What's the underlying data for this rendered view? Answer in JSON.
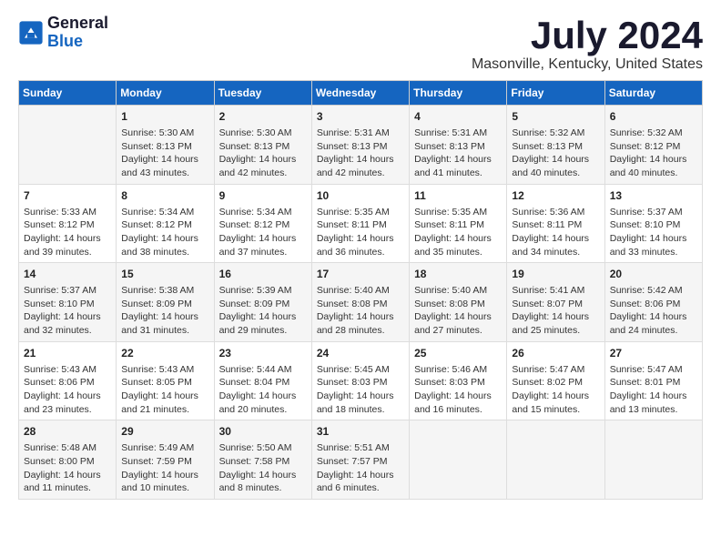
{
  "header": {
    "logo_general": "General",
    "logo_blue": "Blue",
    "title": "July 2024",
    "subtitle": "Masonville, Kentucky, United States"
  },
  "days_of_week": [
    "Sunday",
    "Monday",
    "Tuesday",
    "Wednesday",
    "Thursday",
    "Friday",
    "Saturday"
  ],
  "weeks": [
    [
      {
        "day": "",
        "info": ""
      },
      {
        "day": "1",
        "info": "Sunrise: 5:30 AM\nSunset: 8:13 PM\nDaylight: 14 hours\nand 43 minutes."
      },
      {
        "day": "2",
        "info": "Sunrise: 5:30 AM\nSunset: 8:13 PM\nDaylight: 14 hours\nand 42 minutes."
      },
      {
        "day": "3",
        "info": "Sunrise: 5:31 AM\nSunset: 8:13 PM\nDaylight: 14 hours\nand 42 minutes."
      },
      {
        "day": "4",
        "info": "Sunrise: 5:31 AM\nSunset: 8:13 PM\nDaylight: 14 hours\nand 41 minutes."
      },
      {
        "day": "5",
        "info": "Sunrise: 5:32 AM\nSunset: 8:13 PM\nDaylight: 14 hours\nand 40 minutes."
      },
      {
        "day": "6",
        "info": "Sunrise: 5:32 AM\nSunset: 8:12 PM\nDaylight: 14 hours\nand 40 minutes."
      }
    ],
    [
      {
        "day": "7",
        "info": "Sunrise: 5:33 AM\nSunset: 8:12 PM\nDaylight: 14 hours\nand 39 minutes."
      },
      {
        "day": "8",
        "info": "Sunrise: 5:34 AM\nSunset: 8:12 PM\nDaylight: 14 hours\nand 38 minutes."
      },
      {
        "day": "9",
        "info": "Sunrise: 5:34 AM\nSunset: 8:12 PM\nDaylight: 14 hours\nand 37 minutes."
      },
      {
        "day": "10",
        "info": "Sunrise: 5:35 AM\nSunset: 8:11 PM\nDaylight: 14 hours\nand 36 minutes."
      },
      {
        "day": "11",
        "info": "Sunrise: 5:35 AM\nSunset: 8:11 PM\nDaylight: 14 hours\nand 35 minutes."
      },
      {
        "day": "12",
        "info": "Sunrise: 5:36 AM\nSunset: 8:11 PM\nDaylight: 14 hours\nand 34 minutes."
      },
      {
        "day": "13",
        "info": "Sunrise: 5:37 AM\nSunset: 8:10 PM\nDaylight: 14 hours\nand 33 minutes."
      }
    ],
    [
      {
        "day": "14",
        "info": "Sunrise: 5:37 AM\nSunset: 8:10 PM\nDaylight: 14 hours\nand 32 minutes."
      },
      {
        "day": "15",
        "info": "Sunrise: 5:38 AM\nSunset: 8:09 PM\nDaylight: 14 hours\nand 31 minutes."
      },
      {
        "day": "16",
        "info": "Sunrise: 5:39 AM\nSunset: 8:09 PM\nDaylight: 14 hours\nand 29 minutes."
      },
      {
        "day": "17",
        "info": "Sunrise: 5:40 AM\nSunset: 8:08 PM\nDaylight: 14 hours\nand 28 minutes."
      },
      {
        "day": "18",
        "info": "Sunrise: 5:40 AM\nSunset: 8:08 PM\nDaylight: 14 hours\nand 27 minutes."
      },
      {
        "day": "19",
        "info": "Sunrise: 5:41 AM\nSunset: 8:07 PM\nDaylight: 14 hours\nand 25 minutes."
      },
      {
        "day": "20",
        "info": "Sunrise: 5:42 AM\nSunset: 8:06 PM\nDaylight: 14 hours\nand 24 minutes."
      }
    ],
    [
      {
        "day": "21",
        "info": "Sunrise: 5:43 AM\nSunset: 8:06 PM\nDaylight: 14 hours\nand 23 minutes."
      },
      {
        "day": "22",
        "info": "Sunrise: 5:43 AM\nSunset: 8:05 PM\nDaylight: 14 hours\nand 21 minutes."
      },
      {
        "day": "23",
        "info": "Sunrise: 5:44 AM\nSunset: 8:04 PM\nDaylight: 14 hours\nand 20 minutes."
      },
      {
        "day": "24",
        "info": "Sunrise: 5:45 AM\nSunset: 8:03 PM\nDaylight: 14 hours\nand 18 minutes."
      },
      {
        "day": "25",
        "info": "Sunrise: 5:46 AM\nSunset: 8:03 PM\nDaylight: 14 hours\nand 16 minutes."
      },
      {
        "day": "26",
        "info": "Sunrise: 5:47 AM\nSunset: 8:02 PM\nDaylight: 14 hours\nand 15 minutes."
      },
      {
        "day": "27",
        "info": "Sunrise: 5:47 AM\nSunset: 8:01 PM\nDaylight: 14 hours\nand 13 minutes."
      }
    ],
    [
      {
        "day": "28",
        "info": "Sunrise: 5:48 AM\nSunset: 8:00 PM\nDaylight: 14 hours\nand 11 minutes."
      },
      {
        "day": "29",
        "info": "Sunrise: 5:49 AM\nSunset: 7:59 PM\nDaylight: 14 hours\nand 10 minutes."
      },
      {
        "day": "30",
        "info": "Sunrise: 5:50 AM\nSunset: 7:58 PM\nDaylight: 14 hours\nand 8 minutes."
      },
      {
        "day": "31",
        "info": "Sunrise: 5:51 AM\nSunset: 7:57 PM\nDaylight: 14 hours\nand 6 minutes."
      },
      {
        "day": "",
        "info": ""
      },
      {
        "day": "",
        "info": ""
      },
      {
        "day": "",
        "info": ""
      }
    ]
  ]
}
